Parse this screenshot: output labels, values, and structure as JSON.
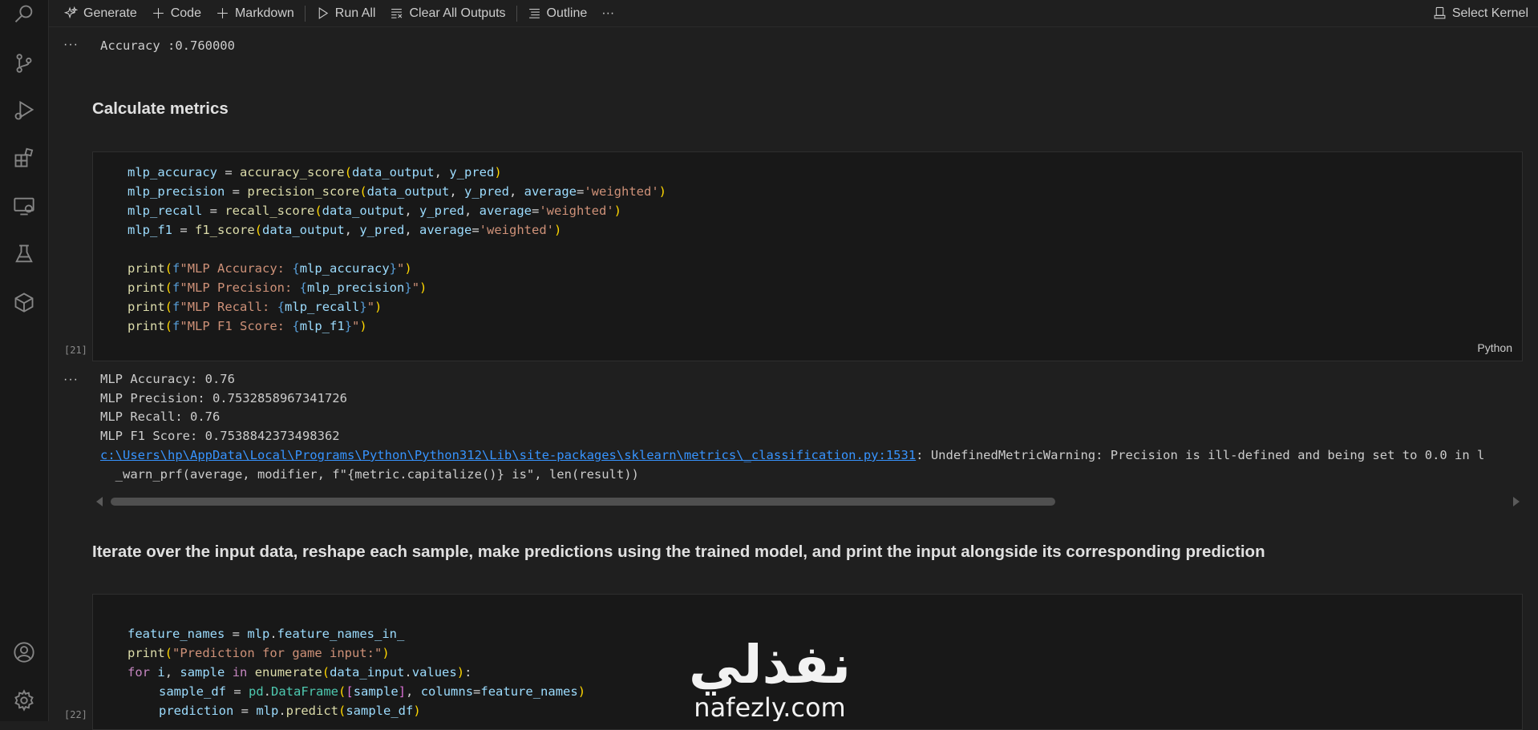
{
  "toolbar": {
    "generate": "Generate",
    "code": "Code",
    "markdown": "Markdown",
    "run_all": "Run All",
    "clear_outputs": "Clear All Outputs",
    "outline": "Outline",
    "more": "···",
    "select_kernel": "Select Kernel"
  },
  "activity_bar": [
    "search-icon",
    "source-control-icon",
    "run-debug-icon",
    "extensions-icon",
    "remote-explorer-icon",
    "testing-icon",
    "package-icon",
    "account-icon",
    "settings-icon"
  ],
  "cells": {
    "prev_output": "Accuracy :0.760000",
    "md1": "Calculate metrics",
    "cell21": {
      "count": "[21]",
      "language": "Python"
    },
    "output21": {
      "lines": [
        "MLP Accuracy: 0.76",
        "MLP Precision: 0.7532858967341726",
        "MLP Recall: 0.76",
        "MLP F1 Score: 0.7538842373498362"
      ],
      "warning_link": "c:\\Users\\hp\\AppData\\Local\\Programs\\Python\\Python312\\Lib\\site-packages\\sklearn\\metrics\\_classification.py:1531",
      "warning_text": ": UndefinedMetricWarning: Precision is ill-defined and being set to 0.0 in l",
      "warning_line2": "  _warn_prf(average, modifier, f\"{metric.capitalize()} is\", len(result))"
    },
    "md2": "Iterate over the input data, reshape each sample, make predictions using the trained model, and print the input alongside its corresponding prediction",
    "cell22": {
      "count": "[22]"
    }
  },
  "watermark": {
    "arabic": "نفذلي",
    "latin": "nafezly.com"
  },
  "colors": {
    "background": "#1f1f1f",
    "cell_background": "#181818",
    "variable": "#9cdcfe",
    "function": "#dcdcaa",
    "string": "#ce9178",
    "link": "#3794ff"
  }
}
